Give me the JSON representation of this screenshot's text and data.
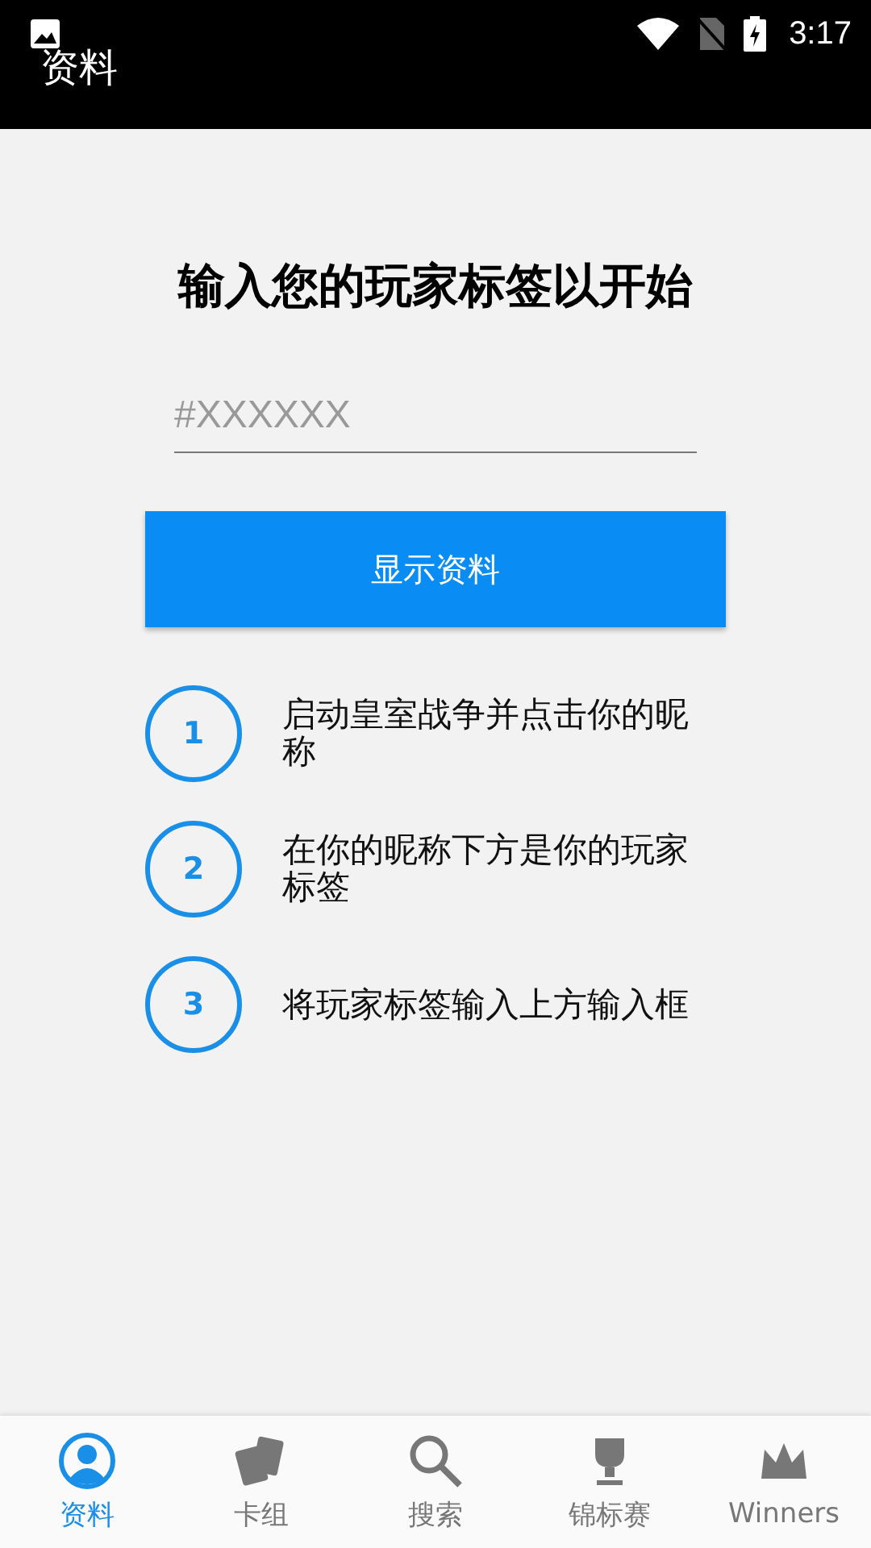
{
  "status_bar": {
    "time": "3:17"
  },
  "app_bar": {
    "title": "资料"
  },
  "heading": "输入您的玩家标签以开始",
  "tag_field": {
    "placeholder": "#XXXXXX"
  },
  "show_button": "显示资料",
  "steps": [
    {
      "number": "1",
      "text": "启动皇室战争并点击你的昵称"
    },
    {
      "number": "2",
      "text": "在你的昵称下方是你的玩家标签"
    },
    {
      "number": "3",
      "text": "将玩家标签输入上方输入框"
    }
  ],
  "tabs": [
    {
      "label": "资料",
      "kind": "profile",
      "selected": true
    },
    {
      "label": "卡组",
      "kind": "cards",
      "selected": false
    },
    {
      "label": "搜索",
      "kind": "search",
      "selected": false
    },
    {
      "label": "锦标赛",
      "kind": "tournament",
      "selected": false
    },
    {
      "label": "Winners",
      "kind": "winners",
      "selected": false
    }
  ]
}
